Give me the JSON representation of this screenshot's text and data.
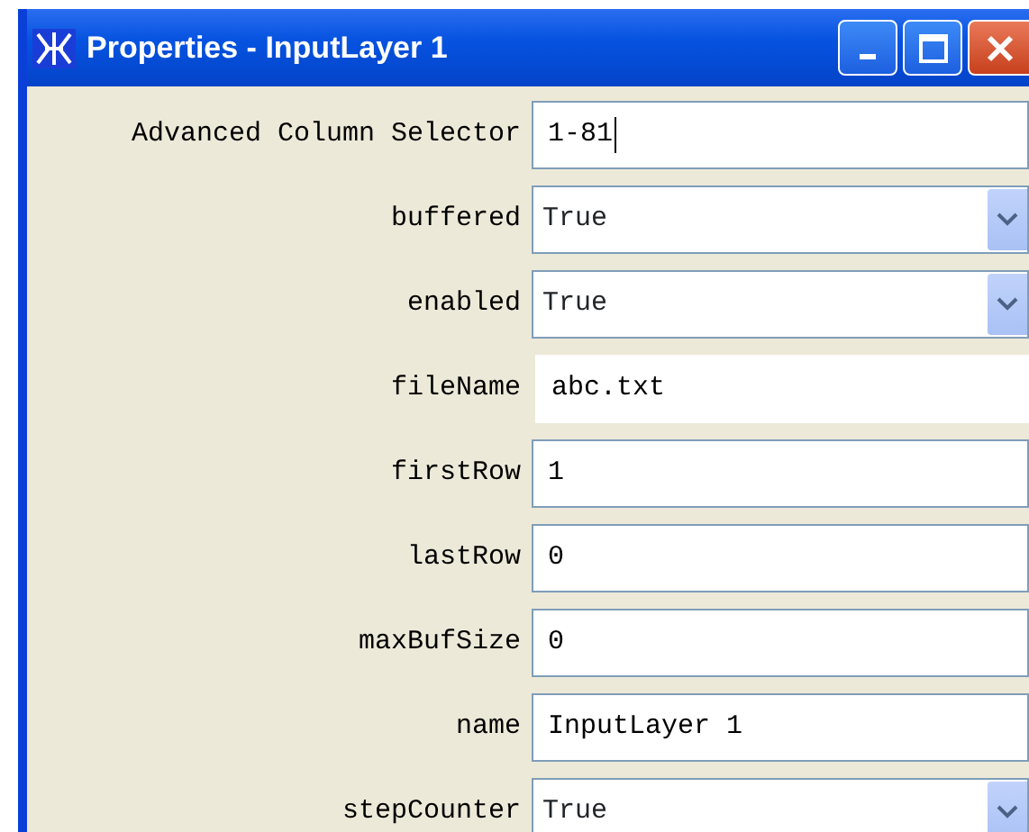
{
  "window": {
    "title": "Properties - InputLayer 1"
  },
  "properties": [
    {
      "label": "Advanced Column Selector",
      "kind": "text",
      "value": "1-81",
      "focused": true
    },
    {
      "label": "buffered",
      "kind": "combo",
      "value": "True"
    },
    {
      "label": "enabled",
      "kind": "combo",
      "value": "True"
    },
    {
      "label": "fileName",
      "kind": "readonly",
      "value": "abc.txt"
    },
    {
      "label": "firstRow",
      "kind": "text",
      "value": "1"
    },
    {
      "label": "lastRow",
      "kind": "text",
      "value": "0"
    },
    {
      "label": "maxBufSize",
      "kind": "text",
      "value": "0"
    },
    {
      "label": "name",
      "kind": "text",
      "value": "InputLayer 1"
    },
    {
      "label": "stepCounter",
      "kind": "combo",
      "value": "True"
    }
  ]
}
